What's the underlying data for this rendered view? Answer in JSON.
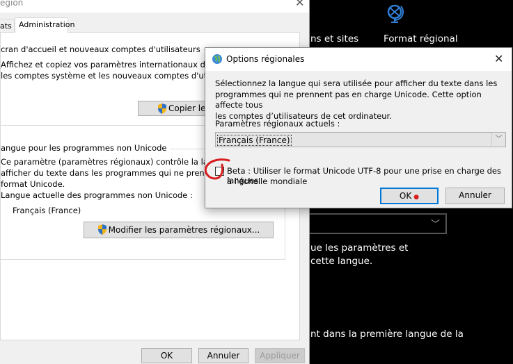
{
  "region_window": {
    "title": "égion",
    "tabs": [
      {
        "label": "ats"
      },
      {
        "label": "Administration",
        "active": true
      }
    ],
    "welcome_group": {
      "label": "cran d'accueil et nouveaux comptes d'utilisateurs",
      "desc_line1": "Affichez et copiez vos paramètres internationaux dans l'é",
      "desc_line2": "les comptes système et les nouveaux comptes d'utilisate",
      "copy_button": "Copier les"
    },
    "unicode_group": {
      "label": "angue pour les programmes non Unicode",
      "desc_line1": "Ce paramètre (paramètres régionaux) contrôle la langue",
      "desc_line2": "afficher du texte dans les programmes qui ne prennent",
      "desc_line3": "format Unicode.",
      "current_label": "Langue actuelle des programmes non Unicode :",
      "current_value": "Français (France)",
      "change_button": "Modifier les paramètres régionaux..."
    },
    "buttons": {
      "ok": "OK",
      "cancel": "Annuler",
      "apply": "Appliquer"
    }
  },
  "settings_panel": {
    "nav_left": "ns et sites",
    "nav_active": "Format régional",
    "text1": "ue les paramètres et",
    "text2": "cette langue.",
    "text3": "nt dans la première langue de la",
    "accent": "#2f7fd6"
  },
  "options_dialog": {
    "title": "Options régionales",
    "description": [
      "Sélectionnez la langue qui sera utilisée pour afficher du texte dans les",
      "programmes qui ne prennent pas en charge Unicode. Cette option affecte tous",
      "les comptes d’utilisateurs de cet ordinateur."
    ],
    "locale_label": "Paramètres régionaux actuels :",
    "locale_value": "Français (France)",
    "beta_checkbox": {
      "line1": "Beta : Utiliser le format Unicode UTF-8 pour une prise en charge des langues",
      "line2": "à l'échelle mondiale",
      "checked": false
    },
    "ok_button": "OK",
    "cancel_button": "Annuler",
    "annotation_color": "#d81e1e"
  }
}
